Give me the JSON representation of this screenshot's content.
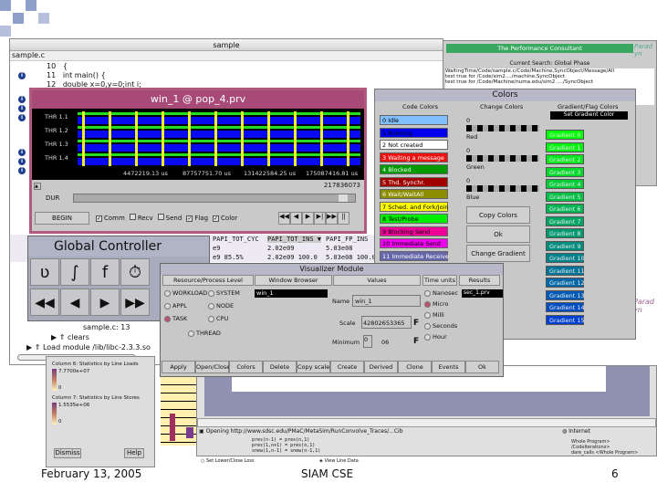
{
  "sample_window": {
    "title": "sample",
    "file_tab": "sample.c",
    "lines": [
      {
        "num": "10",
        "text": "{"
      },
      {
        "num": "11",
        "text": "int main() {"
      },
      {
        "num": "12",
        "text": "double x=0,y=0;int i;"
      }
    ],
    "status": "sample.c: 13",
    "tree": [
      "clears",
      "Load module /lib/libc-2.3.3.so"
    ],
    "columns": [
      "PAPI_TOT_CYC",
      "PAPI_TOT_INS ▼",
      "PAPI_FP_INS"
    ],
    "rows": [
      [
        "e9",
        "2.02e09",
        "5.03e08"
      ],
      [
        "e9 85.5%",
        "2.02e09 100.0",
        "5.03e08 100.0"
      ]
    ]
  },
  "trace_window": {
    "title": "win_1 @ pop_4.prv",
    "threads": [
      "THR 1.1",
      "THR 1.2",
      "THR 1.3",
      "THR 1.4"
    ],
    "time_ticks": [
      "4472219.13 us",
      "87757751.70 us",
      "131422584.25 us",
      "175087416.81 us"
    ],
    "end_time": "217836073",
    "dur_label": "DUR",
    "begin_button": "BEGIN",
    "checks": [
      {
        "label": "Comm",
        "checked": true
      },
      {
        "label": "Recv",
        "checked": false
      },
      {
        "label": "Send",
        "checked": false
      },
      {
        "label": "Flag",
        "checked": true
      },
      {
        "label": "Color",
        "checked": true
      }
    ],
    "nav": [
      "◀◀",
      "◀",
      "▶",
      "▶|",
      "▶▶",
      "||"
    ]
  },
  "colors_window": {
    "title": "Colors",
    "col1": "Code Colors",
    "col2": "Change Colors",
    "col3": "Gradient/Flag Colors",
    "set_gradient": "Set Gradient Color",
    "states": [
      {
        "label": "0 Idle",
        "color": "#80c0ff",
        "fg": "#000"
      },
      {
        "label": "1 Running",
        "color": "#0000ee",
        "fg": "#000"
      },
      {
        "label": "2 Not created",
        "color": "#ffffff",
        "fg": "#000"
      },
      {
        "label": "3 Waiting a message",
        "color": "#ee1111",
        "fg": "#fff"
      },
      {
        "label": "4 Blocked",
        "color": "#009900",
        "fg": "#fff"
      },
      {
        "label": "5 Thd. Synchr.",
        "color": "#a00000",
        "fg": "#fff"
      },
      {
        "label": "6 Wait/WaitAll",
        "color": "#8c8c00",
        "fg": "#fff"
      },
      {
        "label": "7 Sched. and Fork/Join",
        "color": "#ffff00",
        "fg": "#000"
      },
      {
        "label": "8 Test/Probe",
        "color": "#00ee00",
        "fg": "#000"
      },
      {
        "label": "9 Blocking Send",
        "color": "#ee0099",
        "fg": "#000"
      },
      {
        "label": "10 Immediate Send",
        "color": "#ee00ee",
        "fg": "#000"
      },
      {
        "label": "11 Immediate Receive",
        "color": "#6666aa",
        "fg": "#fff"
      }
    ],
    "channels": [
      {
        "value": "0",
        "label": "Red"
      },
      {
        "value": "0",
        "label": "Green"
      },
      {
        "value": "0",
        "label": "Blue"
      }
    ],
    "buttons": [
      "Copy Colors",
      "Ok",
      "Change Gradient"
    ],
    "gradients": [
      "Gradient 0",
      "Gradient 1",
      "Gradient 2",
      "Gradient 3",
      "Gradient 4",
      "Gradient 5",
      "Gradient 6",
      "Gradient 7",
      "Gradient 8",
      "Gradient 9",
      "Gradient 10",
      "Gradient 11",
      "Gradient 12",
      "Gradient 13",
      "Gradient 14",
      "Gradient 15"
    ]
  },
  "paradyn": {
    "header": "The Performance Consultant",
    "search": "Current Search: Global Phase",
    "log": [
      "WaitingTime/Code/sample.c/Code/Machine,SyncObject/Message/All",
      "test true for /Code/sim2..../machine,SyncObject",
      "test true for /Code/Machine/numa.edu/sim2 ..../SyncObject"
    ],
    "logo": "Paradyn"
  },
  "global_controller": {
    "title": "Global Controller",
    "icons": [
      "ʋ",
      "∫",
      "f",
      "⏱"
    ],
    "nav": [
      "◀◀",
      "◀",
      "▶",
      "▶▶"
    ]
  },
  "visualizer": {
    "title": "Visualizer Module",
    "headers": [
      "Resource/Process Level",
      "Window Browser",
      "Values",
      "Time units",
      "Results"
    ],
    "levels": [
      {
        "label": "WORKLOAD",
        "on": false
      },
      {
        "label": "SYSTEM",
        "on": false
      },
      {
        "label": "APPL",
        "on": false
      },
      {
        "label": "NODE",
        "on": false
      },
      {
        "label": "TASK",
        "on": true
      },
      {
        "label": "CPU",
        "on": false
      },
      {
        "label": "THREAD",
        "on": false
      }
    ],
    "window_item": "win_1",
    "name_label": "Name",
    "name_value": "win_1",
    "scale_label": "Scale",
    "scale_value": "42802653365",
    "minimum_label": "Minimum",
    "minimum_value": "0",
    "units_value": "06",
    "flag": "F",
    "units": [
      {
        "label": "Nanosec",
        "on": false
      },
      {
        "label": "Micro",
        "on": true
      },
      {
        "label": "Milli",
        "on": false
      },
      {
        "label": "Seconds",
        "on": false
      },
      {
        "label": "Hour",
        "on": false
      }
    ],
    "result": "sec_1.prv",
    "buttons": [
      "Apply",
      "Open/Close",
      "Colors",
      "Delete",
      "Copy scale",
      "Create",
      "Derived",
      "Clone",
      "Events",
      "Ok"
    ]
  },
  "stats_panel": {
    "items": [
      {
        "label": "Column 6: Statistics by Line Loads",
        "max": "7.7700e+07",
        "min": "0"
      },
      {
        "label": "Column 7: Statistics by Line Stores",
        "max": "1.5535e+06",
        "min": "0"
      }
    ],
    "buttons": [
      "Dismiss",
      "Help"
    ]
  },
  "browser": {
    "status": "Opening http://www.sdsc.edu/PMaC/MetaSim/RunConvolve_Traces/...Cib",
    "zone": "Internet",
    "options": [
      "Set Lower/Close Loss",
      "View Line Data"
    ],
    "code": [
      "pres(n-1) = pres(n,1)",
      "pres(1,n+1) = pres(n,1)",
      "snew(1,n-1) = snew(n-1,1)"
    ],
    "xml": [
      "Whole Program>",
      "/CodeIterations>",
      "dare_calls <Whole Program>"
    ]
  },
  "footer": {
    "date": "February 13, 2005",
    "title": "SIAM CSE",
    "page": "6"
  }
}
